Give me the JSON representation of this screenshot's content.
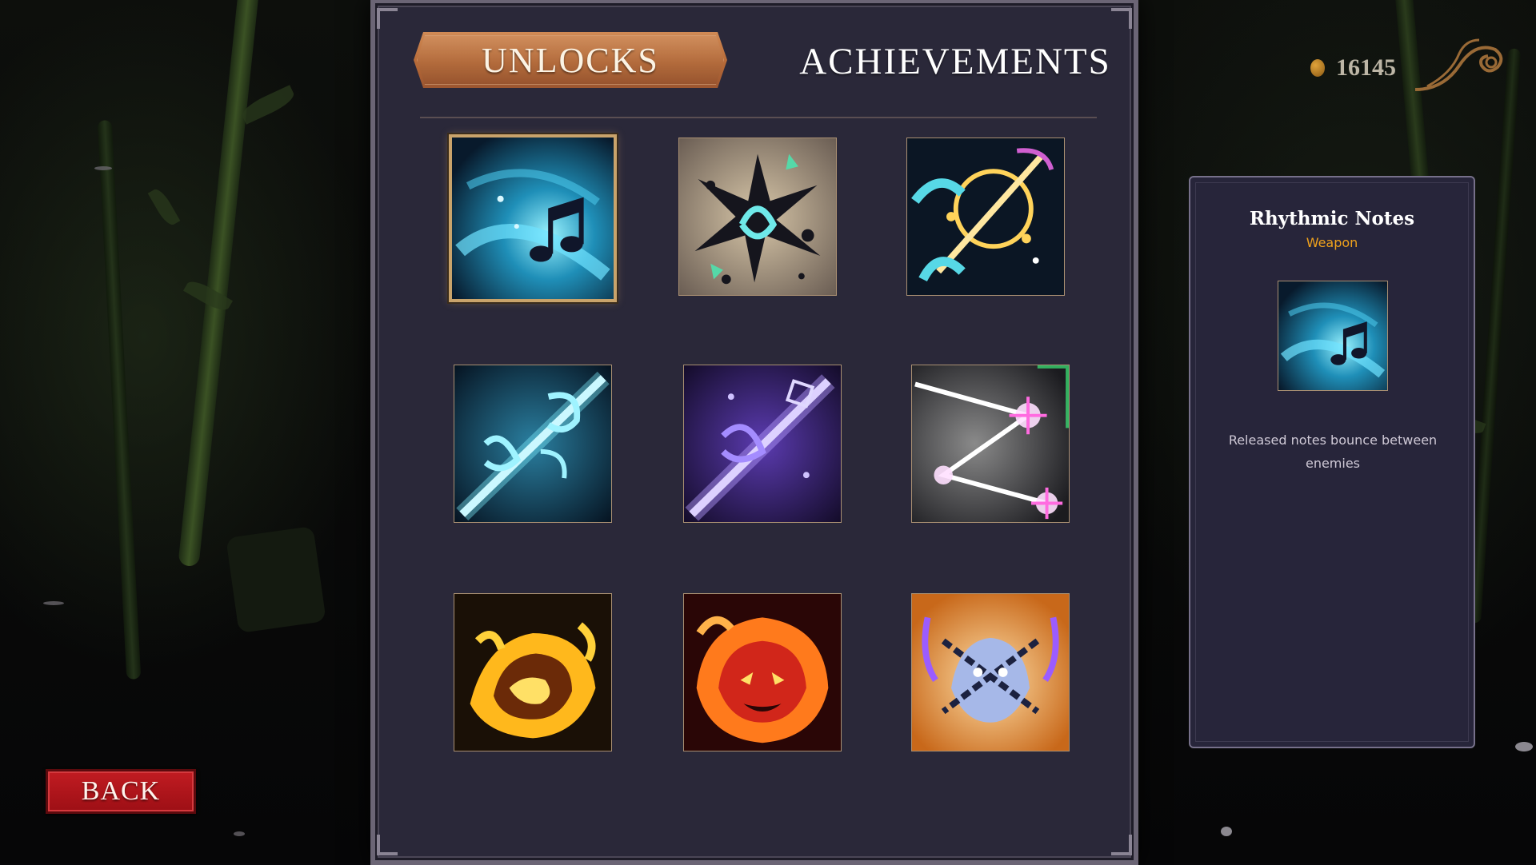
{
  "tabs": {
    "unlocks": "UNLOCKS",
    "achievements": "ACHIEVEMENTS",
    "active": "unlocks"
  },
  "currency": {
    "value": "16145",
    "icon": "coin-icon"
  },
  "grid": {
    "items": [
      {
        "id": "rhythmic-notes",
        "icon": "music-notes-wave-icon",
        "palette": "cyan",
        "selected": true
      },
      {
        "id": "shard-burst",
        "icon": "shatter-burst-icon",
        "palette": "dark-burst"
      },
      {
        "id": "note-orbit",
        "icon": "orbiting-notes-icon",
        "palette": "cyan-gold"
      },
      {
        "id": "cyan-slash",
        "icon": "cyan-slash-icon",
        "palette": "cyan"
      },
      {
        "id": "violet-slash",
        "icon": "violet-slash-icon",
        "palette": "violet"
      },
      {
        "id": "prism-lines",
        "icon": "prism-bounce-icon",
        "palette": "prism"
      },
      {
        "id": "golden-flame",
        "icon": "golden-fire-icon",
        "palette": "gold"
      },
      {
        "id": "fire-demon",
        "icon": "fire-demon-icon",
        "palette": "red-fire"
      },
      {
        "id": "chained-spirit",
        "icon": "chained-beast-icon",
        "palette": "chain"
      }
    ]
  },
  "detail": {
    "title": "Rhythmic Notes",
    "type": "Weapon",
    "description": "Released notes bounce between enemies",
    "icon": "music-notes-wave-icon"
  },
  "back_label": "BACK",
  "colors": {
    "panel": "#2a2839",
    "tab_active": "#b66a38",
    "accent": "#f0a21c",
    "back_button": "#b0141a",
    "selection_border": "#c9a36b"
  }
}
